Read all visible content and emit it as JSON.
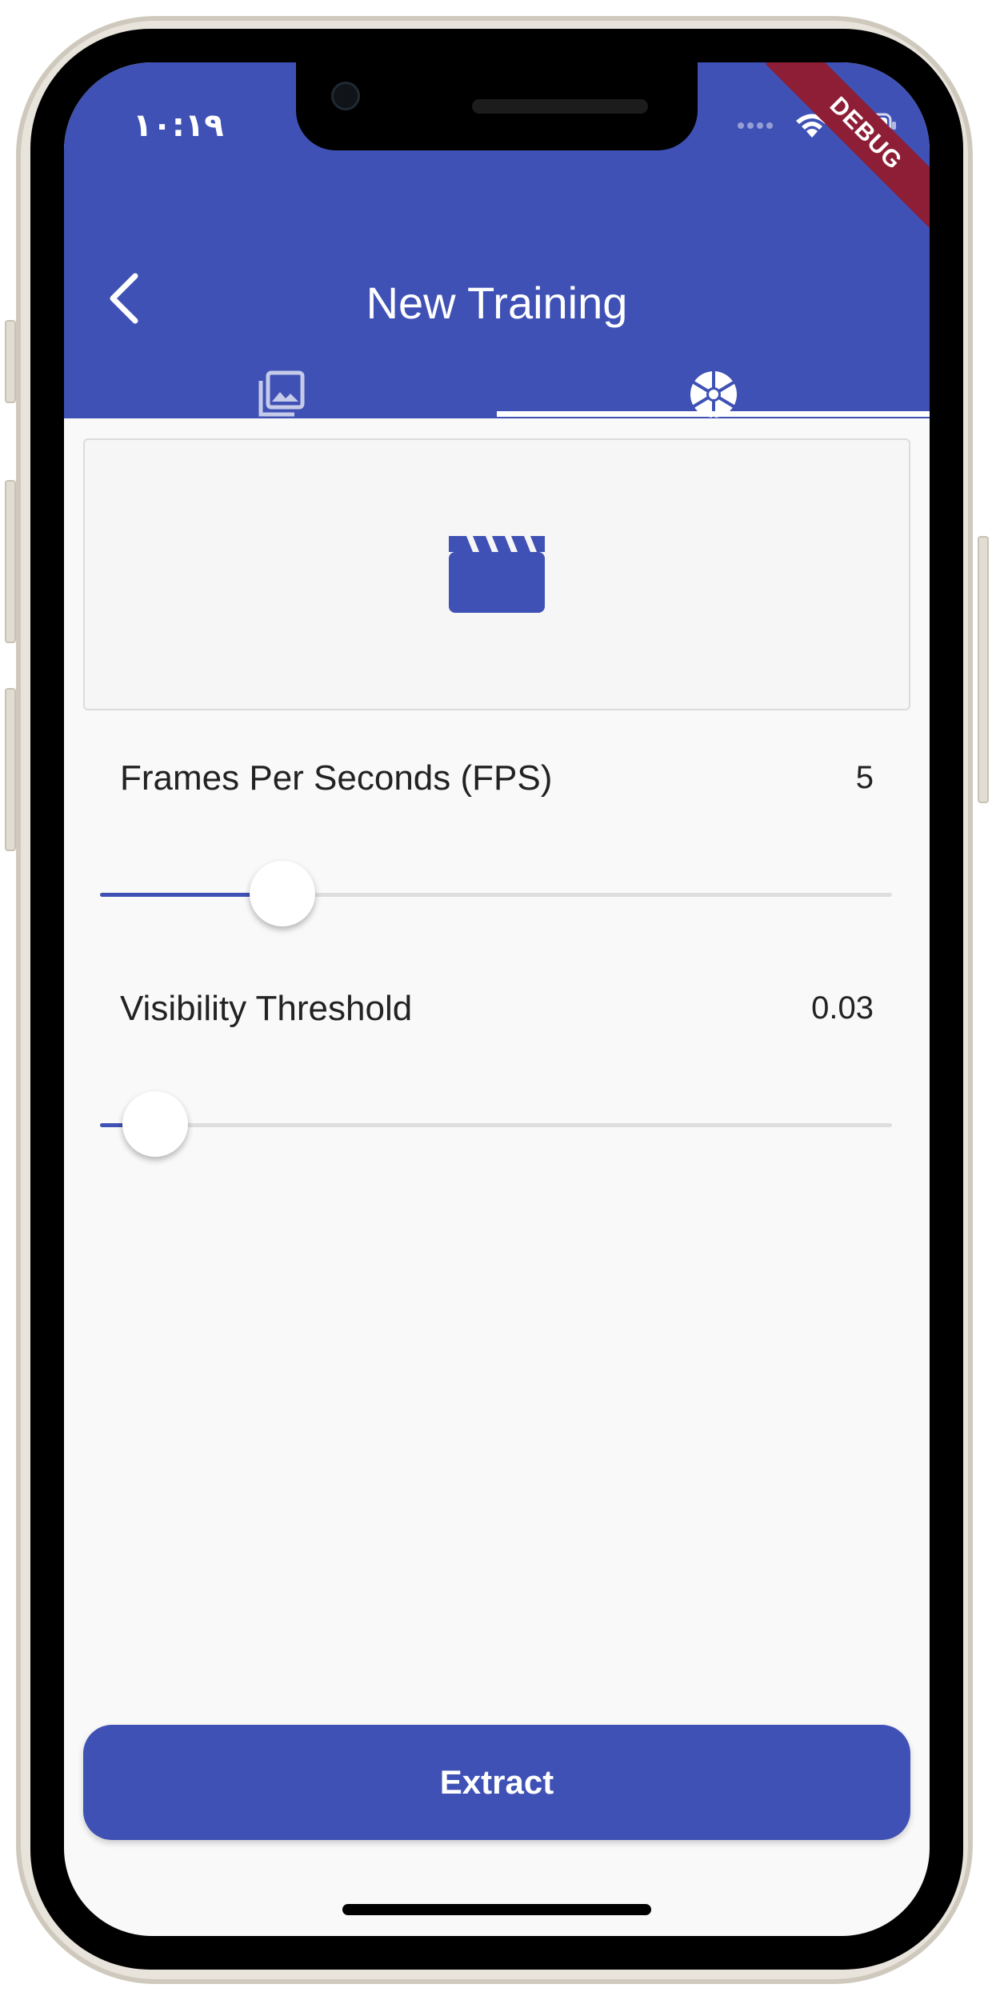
{
  "status_bar": {
    "time": "١٠:١٩"
  },
  "debug_banner": "DEBUG",
  "app_bar": {
    "title": "New Training",
    "back_icon": "chevron-left-icon"
  },
  "tabs": [
    {
      "icon": "photo-library-icon",
      "selected": false
    },
    {
      "icon": "camera-shutter-icon",
      "selected": true
    }
  ],
  "video_placeholder": {
    "icon": "movie-clapper-icon"
  },
  "sliders": [
    {
      "label": "Frames Per Seconds (FPS)",
      "value_text": "5",
      "fraction": 0.23
    },
    {
      "label": "Visibility Threshold",
      "value_text": "0.03",
      "fraction": 0.07
    }
  ],
  "extract_button": {
    "label": "Extract"
  },
  "colors": {
    "primary": "#3f51b5",
    "background": "#f9f9f9",
    "debug_banner": "#8e1e36"
  }
}
